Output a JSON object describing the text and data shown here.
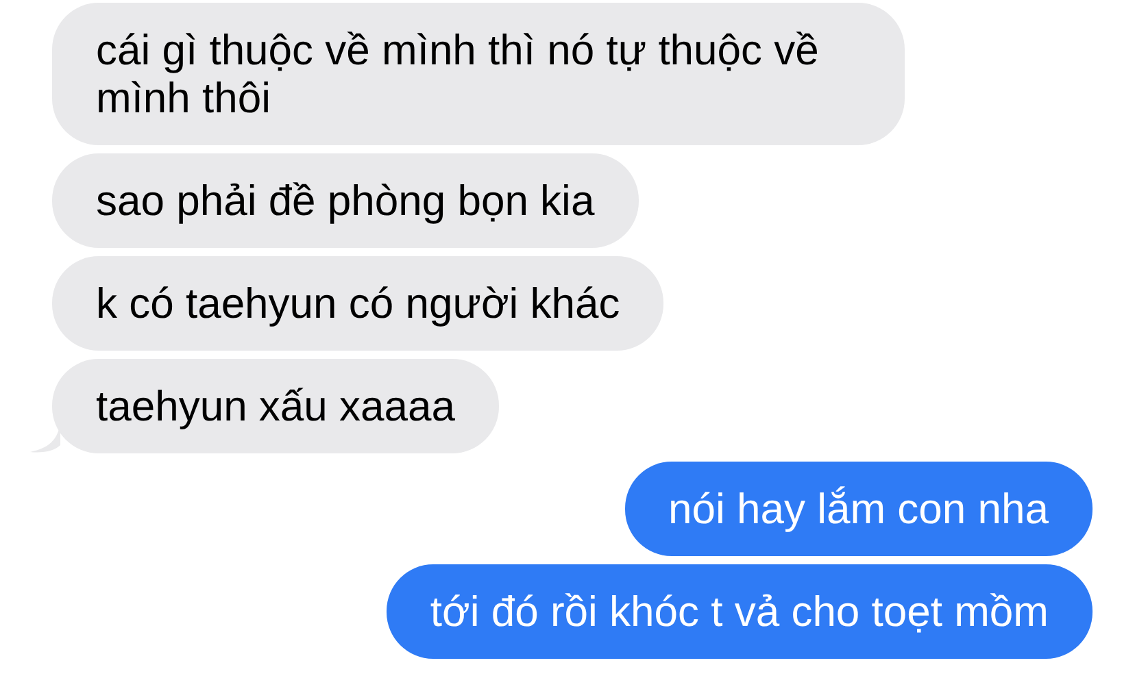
{
  "messages": [
    {
      "text": "cái gì thuộc về mình thì nó tự thuộc về mình thôi",
      "kind": "received",
      "tail": false
    },
    {
      "text": "sao phải đề phòng bọn kia",
      "kind": "received",
      "tail": false
    },
    {
      "text": "k có taehyun có người khác",
      "kind": "received",
      "tail": false
    },
    {
      "text": "taehyun xấu xaaaa",
      "kind": "received",
      "tail": true
    },
    {
      "text": "nói hay lắm con nha",
      "kind": "sent",
      "tail": false
    },
    {
      "text": "tới đó rồi khóc t vả cho toẹt mồm",
      "kind": "sent",
      "tail": false
    }
  ]
}
